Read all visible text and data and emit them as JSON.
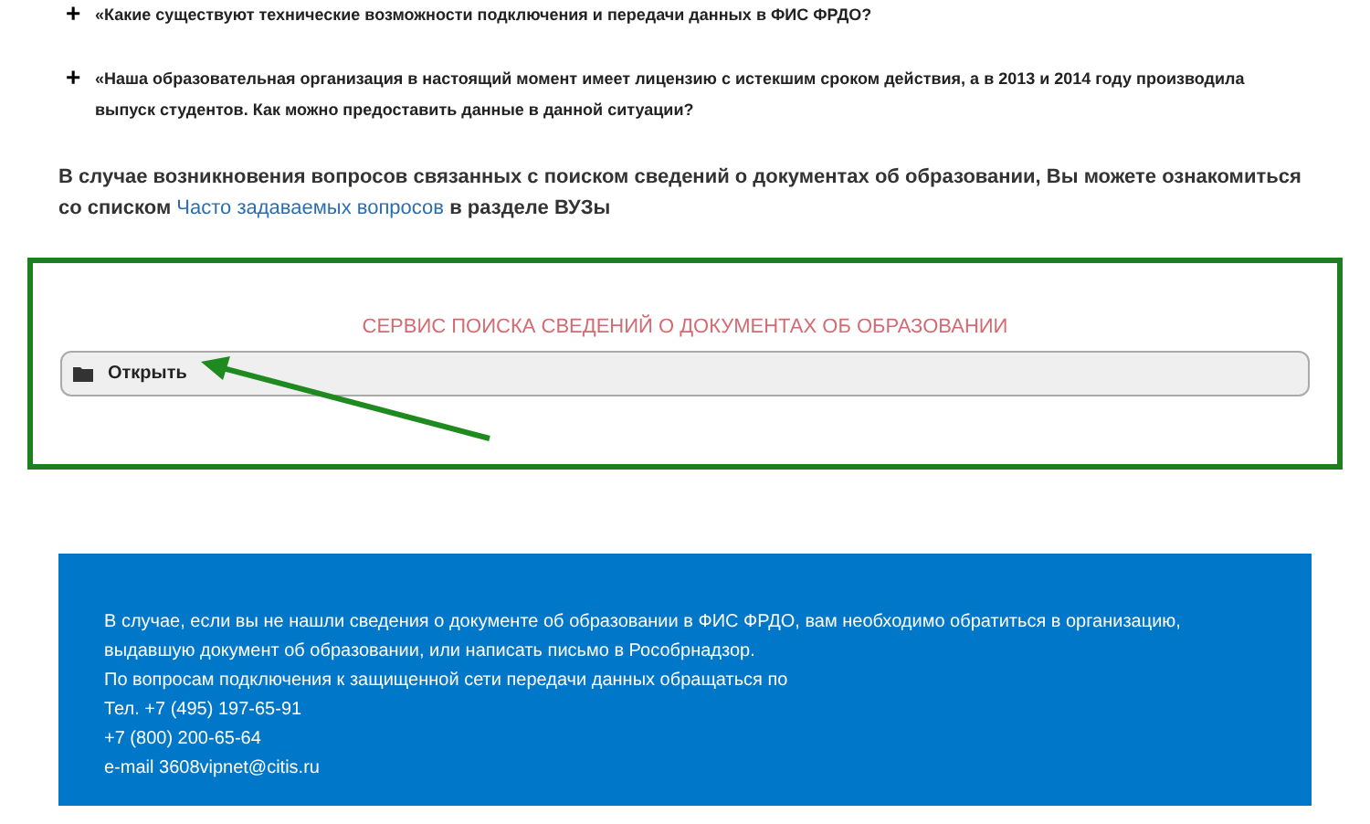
{
  "faq_items": [
    {
      "icon": "+",
      "text": "«Какие существуют технические возможности подключения и передачи данных в ФИС ФРДО?"
    },
    {
      "icon": "+",
      "text": "«Наша образовательная организация в настоящий момент имеет лицензию с истекшим сроком действия, а в 2013 и 2014 году производила выпуск студентов. Как можно предоставить данные в данной ситуации?"
    }
  ],
  "info": {
    "text": "В случае возникновения вопросов связанных с поиском сведений о документах об образовании, Вы можете ознакомиться со списком",
    "link": "Часто задаваемых вопросов",
    "after": "в разделе ВУЗы"
  },
  "service": {
    "title": "СЕРВИС ПОИСКА СВЕДЕНИЙ О ДОКУМЕНТАХ ОБ ОБРАЗОВАНИИ",
    "button": "Открыть"
  },
  "contact_lines": [
    "В случае, если вы не нашли сведения о документе об образовании в ФИС ФРДО, вам необходимо обратиться в организацию, выдавшую документ об образовании, или написать письмо в Рособрнадзор.",
    "По вопросам подключения к защищенной сети передачи данных обращаться по",
    "Тел. +7 (495) 197-65-91",
    "+7 (800) 200-65-64",
    "e-mail 3608vipnet@citis.ru"
  ]
}
